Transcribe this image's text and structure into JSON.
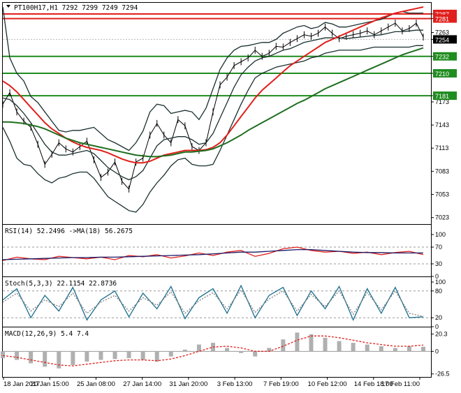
{
  "chart_data": [
    {
      "pane": "main",
      "type": "line",
      "title": "PT100H17,H1  7292 7299 7249 7294",
      "symbol": "PT100H17",
      "timeframe": "H1",
      "header_values": [
        7292,
        7299,
        7249,
        7294
      ],
      "ylim": [
        7020,
        7296
      ],
      "yticks": [
        7287,
        7281,
        7263,
        7254,
        7232,
        7210,
        7181,
        7173,
        7143,
        7113,
        7083,
        7053,
        7023
      ],
      "x_labels": [
        "18 Jan 2017",
        "20 Jan 15:00",
        "25 Jan 08:00",
        "27 Jan 14:00",
        "31 Jan 20:00",
        "3 Feb 13:00",
        "7 Feb 19:00",
        "10 Feb 12:00",
        "14 Feb 18:00",
        "17 Feb 11:00"
      ],
      "horizontal_levels": [
        {
          "value": 7287,
          "color": "#e0201c"
        },
        {
          "value": 7281,
          "color": "#e0201c"
        },
        {
          "value": 7232,
          "color": "#1f8c1f"
        },
        {
          "value": 7210,
          "color": "#1f8c1f"
        },
        {
          "value": 7181,
          "color": "#1f8c1f"
        }
      ],
      "current_price": 7254,
      "x_index": [
        0,
        5,
        10,
        15,
        20,
        25,
        30,
        35,
        40,
        45,
        50,
        55,
        60,
        65,
        70,
        75,
        80,
        85,
        90,
        95,
        100,
        105,
        110,
        115,
        120,
        125,
        130,
        135,
        140,
        145,
        150,
        155,
        160,
        165,
        170,
        175,
        180,
        185,
        190,
        195,
        200,
        205,
        210,
        215,
        220,
        225,
        230,
        235,
        240,
        245,
        250,
        255,
        260,
        265,
        270,
        275,
        280,
        285,
        290,
        295,
        300
      ],
      "series": [
        {
          "name": "price",
          "color": "#000000",
          "values": [
            7170,
            7185,
            7160,
            7148,
            7140,
            7118,
            7092,
            7105,
            7120,
            7112,
            7108,
            7115,
            7122,
            7098,
            7075,
            7082,
            7095,
            7070,
            7060,
            7095,
            7100,
            7130,
            7145,
            7130,
            7120,
            7150,
            7142,
            7115,
            7110,
            7120,
            7160,
            7195,
            7205,
            7220,
            7225,
            7230,
            7240,
            7232,
            7236,
            7245,
            7244,
            7250,
            7255,
            7260,
            7258,
            7262,
            7270,
            7262,
            7255,
            7258,
            7260,
            7262,
            7265,
            7260,
            7265,
            7270,
            7275,
            7265,
            7268,
            7275,
            7257
          ]
        },
        {
          "name": "bollinger_mid",
          "color": "#1a2f2f",
          "values": [
            7178,
            7176,
            7168,
            7158,
            7146,
            7132,
            7118,
            7108,
            7104,
            7104,
            7106,
            7108,
            7110,
            7106,
            7097,
            7088,
            7082,
            7076,
            7072,
            7076,
            7084,
            7100,
            7116,
            7124,
            7126,
            7128,
            7128,
            7124,
            7118,
            7120,
            7132,
            7152,
            7172,
            7192,
            7208,
            7218,
            7226,
            7230,
            7232,
            7236,
            7240,
            7242,
            7246,
            7250,
            7252,
            7254,
            7256,
            7256,
            7256,
            7255,
            7256,
            7257,
            7258,
            7259,
            7260,
            7262,
            7264,
            7264,
            7265,
            7266,
            7266
          ]
        },
        {
          "name": "bollinger_upper",
          "color": "#1a2f2f",
          "values": [
            7296,
            7230,
            7210,
            7200,
            7180,
            7172,
            7160,
            7148,
            7136,
            7134,
            7136,
            7136,
            7138,
            7140,
            7132,
            7124,
            7120,
            7115,
            7110,
            7120,
            7135,
            7160,
            7170,
            7168,
            7158,
            7160,
            7162,
            7160,
            7150,
            7165,
            7190,
            7215,
            7230,
            7240,
            7245,
            7246,
            7248,
            7250,
            7250,
            7254,
            7262,
            7266,
            7270,
            7272,
            7268,
            7270,
            7276,
            7274,
            7270,
            7270,
            7272,
            7274,
            7276,
            7278,
            7280,
            7284,
            7288,
            7290,
            7288,
            7288,
            7288
          ]
        },
        {
          "name": "bollinger_lower",
          "color": "#1a2f2f",
          "values": [
            7140,
            7122,
            7100,
            7092,
            7090,
            7080,
            7072,
            7068,
            7074,
            7076,
            7080,
            7082,
            7082,
            7074,
            7062,
            7050,
            7044,
            7038,
            7032,
            7030,
            7040,
            7056,
            7068,
            7078,
            7090,
            7098,
            7100,
            7092,
            7090,
            7090,
            7092,
            7110,
            7130,
            7150,
            7170,
            7188,
            7204,
            7210,
            7214,
            7218,
            7220,
            7222,
            7224,
            7226,
            7230,
            7232,
            7236,
            7238,
            7240,
            7240,
            7240,
            7240,
            7242,
            7244,
            7244,
            7244,
            7244,
            7244,
            7244,
            7246,
            7246
          ]
        },
        {
          "name": "ma_red",
          "color": "#e0201c",
          "values": [
            7200,
            7194,
            7186,
            7176,
            7166,
            7156,
            7146,
            7138,
            7132,
            7126,
            7121,
            7117,
            7114,
            7112,
            7110,
            7107,
            7103,
            7099,
            7096,
            7094,
            7094,
            7096,
            7100,
            7104,
            7106,
            7108,
            7110,
            7110,
            7110,
            7111,
            7114,
            7120,
            7130,
            7142,
            7154,
            7166,
            7178,
            7188,
            7196,
            7204,
            7212,
            7220,
            7226,
            7232,
            7238,
            7244,
            7250,
            7254,
            7258,
            7262,
            7266,
            7270,
            7274,
            7278,
            7282,
            7285,
            7288,
            7290,
            7292,
            7294,
            7296
          ]
        },
        {
          "name": "ma_green",
          "color": "#1f6e1f",
          "values": [
            7147,
            7147,
            7146,
            7145,
            7143,
            7141,
            7138,
            7134,
            7130,
            7126,
            7123,
            7120,
            7118,
            7116,
            7114,
            7112,
            7110,
            7108,
            7106,
            7104,
            7103,
            7102,
            7102,
            7103,
            7104,
            7106,
            7108,
            7108,
            7109,
            7110,
            7112,
            7116,
            7120,
            7125,
            7130,
            7136,
            7141,
            7146,
            7151,
            7156,
            7161,
            7166,
            7171,
            7175,
            7180,
            7185,
            7190,
            7194,
            7198,
            7202,
            7206,
            7210,
            7214,
            7218,
            7222,
            7226,
            7230,
            7234,
            7237,
            7240,
            7243
          ]
        }
      ]
    },
    {
      "pane": "rsi",
      "type": "line",
      "title": "RSI(14) 52.2496  ->MA(18) 56.2675",
      "rsi_value": 52.2496,
      "ma_value": 56.2675,
      "ylim": [
        0,
        100
      ],
      "yticks": [
        100,
        70,
        30,
        0
      ],
      "x_index": [
        0,
        10,
        20,
        30,
        40,
        50,
        60,
        70,
        80,
        90,
        100,
        110,
        120,
        130,
        140,
        150,
        160,
        170,
        180,
        190,
        200,
        210,
        220,
        230,
        240,
        250,
        260,
        270,
        280,
        290,
        300
      ],
      "series": [
        {
          "name": "RSI(14)",
          "color": "#e0201c",
          "values": [
            38,
            46,
            42,
            40,
            48,
            45,
            42,
            46,
            40,
            50,
            47,
            52,
            44,
            49,
            56,
            50,
            58,
            62,
            48,
            55,
            66,
            70,
            62,
            58,
            60,
            55,
            58,
            52,
            57,
            60,
            52
          ]
        },
        {
          "name": "MA(18)",
          "color": "#1a1a66",
          "values": [
            40,
            41,
            42,
            43,
            44,
            45,
            45,
            46,
            46,
            47,
            48,
            49,
            50,
            51,
            52,
            54,
            56,
            58,
            58,
            60,
            62,
            64,
            64,
            62,
            60,
            58,
            57,
            57,
            56,
            56,
            56
          ]
        }
      ]
    },
    {
      "pane": "stoch",
      "type": "line",
      "title": "Stoch(5,3,3) 22.1154 22.8736",
      "main_value": 22.1154,
      "signal_value": 22.8736,
      "ylim": [
        0,
        100
      ],
      "yticks": [
        100,
        80,
        20,
        0
      ],
      "x_index": [
        0,
        10,
        20,
        30,
        40,
        50,
        60,
        70,
        80,
        90,
        100,
        110,
        120,
        130,
        140,
        150,
        160,
        170,
        180,
        190,
        200,
        210,
        220,
        230,
        240,
        250,
        260,
        270,
        280,
        290,
        300
      ],
      "series": [
        {
          "name": "%K",
          "color": "#1a6e8c",
          "values": [
            60,
            85,
            20,
            70,
            35,
            88,
            15,
            60,
            80,
            22,
            75,
            40,
            90,
            18,
            65,
            85,
            30,
            92,
            20,
            70,
            88,
            25,
            80,
            40,
            90,
            15,
            85,
            30,
            88,
            20,
            22
          ]
        },
        {
          "name": "%D",
          "color": "#7f7f7f",
          "values": [
            55,
            75,
            35,
            60,
            45,
            75,
            30,
            55,
            70,
            35,
            65,
            48,
            78,
            30,
            58,
            76,
            40,
            82,
            32,
            62,
            80,
            35,
            72,
            45,
            80,
            28,
            76,
            38,
            80,
            30,
            23
          ]
        }
      ]
    },
    {
      "pane": "macd",
      "type": "bar",
      "title": "MACD(12,26,9) 5.4 7.4",
      "macd_value": 5.4,
      "signal_value": 7.4,
      "ylim": [
        -30,
        24
      ],
      "yticks": [
        20.3,
        0.0,
        -26.5
      ],
      "x_index": [
        0,
        10,
        20,
        30,
        40,
        50,
        60,
        70,
        80,
        90,
        100,
        110,
        120,
        130,
        140,
        150,
        160,
        170,
        180,
        190,
        200,
        210,
        220,
        230,
        240,
        250,
        260,
        270,
        280,
        290,
        300
      ],
      "series": [
        {
          "name": "MACD",
          "color": "#b0b0b0",
          "values": [
            -8,
            -10,
            -14,
            -18,
            -20,
            -16,
            -12,
            -10,
            -9,
            -8,
            -10,
            -12,
            -6,
            2,
            8,
            10,
            4,
            -2,
            -6,
            4,
            14,
            22,
            20,
            16,
            12,
            10,
            8,
            6,
            4,
            6,
            5.4
          ]
        },
        {
          "name": "Signal",
          "color": "#e0201c",
          "values": [
            -5,
            -7,
            -10,
            -13,
            -16,
            -17,
            -15,
            -13,
            -11,
            -10,
            -10,
            -11,
            -9,
            -5,
            0,
            5,
            6,
            4,
            0,
            0,
            6,
            13,
            18,
            18,
            16,
            13,
            10,
            8,
            6,
            6,
            7.4
          ]
        }
      ]
    }
  ]
}
